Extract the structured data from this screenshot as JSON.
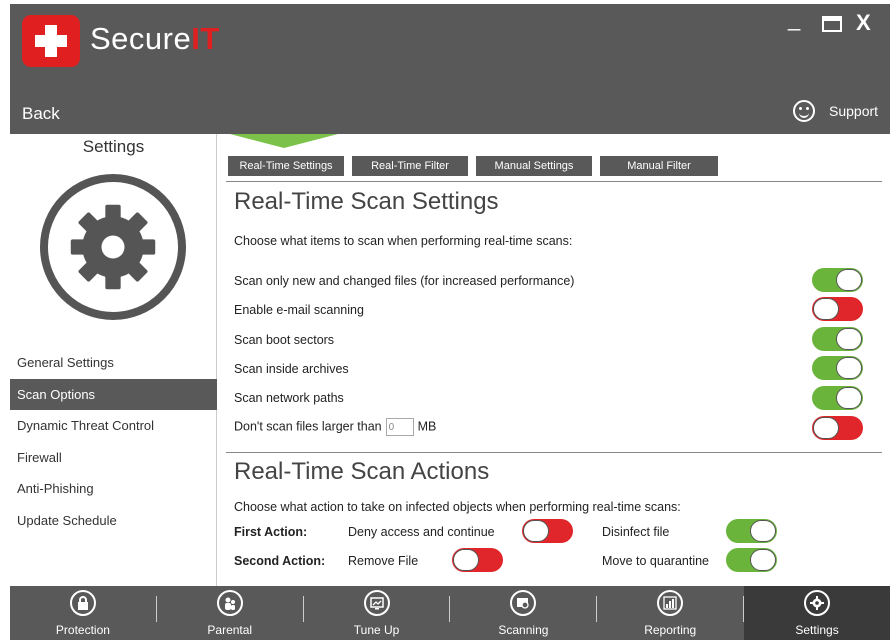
{
  "app": {
    "brand_prefix": "Secure",
    "brand_suffix": "IT",
    "back_label": "Back",
    "support_label": "Support",
    "window_controls": {
      "minimize": "_",
      "close": "X"
    }
  },
  "sidebar": {
    "title": "Settings",
    "items": [
      {
        "label": "General Settings",
        "active": false
      },
      {
        "label": "Scan Options",
        "active": true
      },
      {
        "label": "Dynamic Threat Control",
        "active": false
      },
      {
        "label": "Firewall",
        "active": false
      },
      {
        "label": "Anti-Phishing",
        "active": false
      },
      {
        "label": "Update Schedule",
        "active": false
      }
    ]
  },
  "tabs": [
    {
      "label": "Real-Time Settings",
      "active": true
    },
    {
      "label": "Real-Time Filter",
      "active": false
    },
    {
      "label": "Manual Settings",
      "active": false
    },
    {
      "label": "Manual Filter",
      "active": false
    }
  ],
  "scan_settings": {
    "title": "Real-Time Scan Settings",
    "description": "Choose what items to scan when performing real-time scans:",
    "rows": [
      {
        "label": "Scan only new and changed files (for increased performance)",
        "enabled": true
      },
      {
        "label": "Enable e-mail scanning",
        "enabled": false
      },
      {
        "label": "Scan boot sectors",
        "enabled": true
      },
      {
        "label": "Scan inside archives",
        "enabled": true
      },
      {
        "label": "Scan network paths",
        "enabled": true
      }
    ],
    "size_row": {
      "prefix": "Don't scan files larger than",
      "value": "0",
      "unit": "MB",
      "enabled": false
    }
  },
  "scan_actions": {
    "title": "Real-Time Scan Actions",
    "description": "Choose what action to take on infected objects when performing real-time scans:",
    "first_action_label": "First Action:",
    "first_action_value": "Deny access and continue",
    "first_action_enabled": false,
    "disinfect_label": "Disinfect file",
    "disinfect_enabled": true,
    "second_action_label": "Second Action:",
    "second_action_value": "Remove File",
    "second_action_enabled": false,
    "quarantine_label": "Move to quarantine",
    "quarantine_enabled": true
  },
  "bottom_nav": [
    {
      "label": "Protection",
      "icon": "lock-icon",
      "active": false
    },
    {
      "label": "Parental",
      "icon": "parental-icon",
      "active": false
    },
    {
      "label": "Tune Up",
      "icon": "tuneup-icon",
      "active": false
    },
    {
      "label": "Scanning",
      "icon": "scanning-icon",
      "active": false
    },
    {
      "label": "Reporting",
      "icon": "reporting-icon",
      "active": false
    },
    {
      "label": "Settings",
      "icon": "gear-icon",
      "active": true
    }
  ],
  "colors": {
    "toggle_on": "#6ab43c",
    "toggle_off": "#e0262a",
    "brand_red": "#e02020",
    "bar_gray": "#595959"
  }
}
